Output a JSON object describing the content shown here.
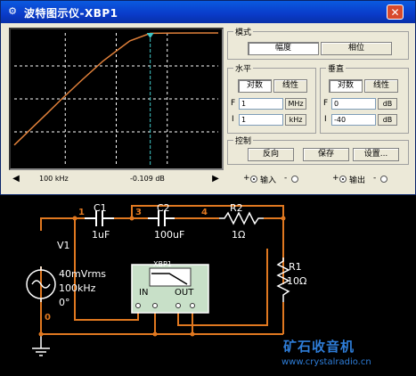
{
  "window": {
    "title": "波特图示仪-XBP1",
    "close_label": "✕"
  },
  "navigation": {
    "left_arrow": "◀",
    "right_arrow": "▶",
    "frequency_readout": "100 kHz",
    "gain_readout": "-0.109 dB"
  },
  "mode": {
    "group_label": "模式",
    "magnitude_label": "幅度",
    "phase_label": "相位",
    "selected": "幅度"
  },
  "horizontal": {
    "group_label": "水平",
    "log_label": "对数",
    "linear_label": "线性",
    "final_prefix": "F",
    "final_value": "1",
    "final_unit": "MHz",
    "initial_prefix": "I",
    "initial_value": "1",
    "initial_unit": "kHz"
  },
  "vertical": {
    "group_label": "垂直",
    "log_label": "对数",
    "linear_label": "线性",
    "final_prefix": "F",
    "final_value": "0",
    "final_unit": "dB",
    "initial_prefix": "I",
    "initial_value": "-40",
    "initial_unit": "dB"
  },
  "controls": {
    "group_label": "控制",
    "reverse_label": "反向",
    "save_label": "保存",
    "settings_label": "设置..."
  },
  "terminals": {
    "in_label": "输入",
    "out_label": "输出",
    "plus": "+",
    "minus": "-"
  },
  "chart_data": {
    "type": "line",
    "x_scale": "log",
    "xlim": [
      1000,
      1000000
    ],
    "ylim": [
      -40,
      0
    ],
    "xunit": "Hz",
    "yunit": "dB",
    "cursor_x": 100000,
    "series": [
      {
        "x": [
          1000,
          2000,
          3000,
          5000,
          10000,
          20000,
          50000,
          100000,
          200000,
          500000,
          1000000
        ],
        "y": [
          -34,
          -28,
          -24.5,
          -20,
          -14.2,
          -8.6,
          -2.4,
          -0.109,
          -0.03,
          -0.005,
          0
        ]
      }
    ],
    "colors": {
      "trace": "#E0803A",
      "cursor": "#40C8C8",
      "grid": "#FFFFFF",
      "bg": "#000000"
    }
  },
  "circuit": {
    "source_name": "V1",
    "source_amplitude": "40mVrms",
    "source_frequency": "100kHz",
    "source_phase": "0°",
    "c1_name": "C1",
    "c1_value": "1uF",
    "c2_name": "C2",
    "c2_value": "100uF",
    "r2_name": "R2",
    "r2_value": "1Ω",
    "r1_name": "R1",
    "r1_value": "10Ω",
    "node_1": "1",
    "node_3": "3",
    "node_4": "4",
    "node_0": "0",
    "bode_in_label": "IN",
    "bode_out_label": "OUT",
    "bode_part_label": "XBP1",
    "wire_color": "#E07820",
    "label_color": "#FFFFFF",
    "node_color": "#E07820"
  },
  "watermark": {
    "brand": "矿石收音机",
    "url": "www.crystalradio.cn"
  }
}
